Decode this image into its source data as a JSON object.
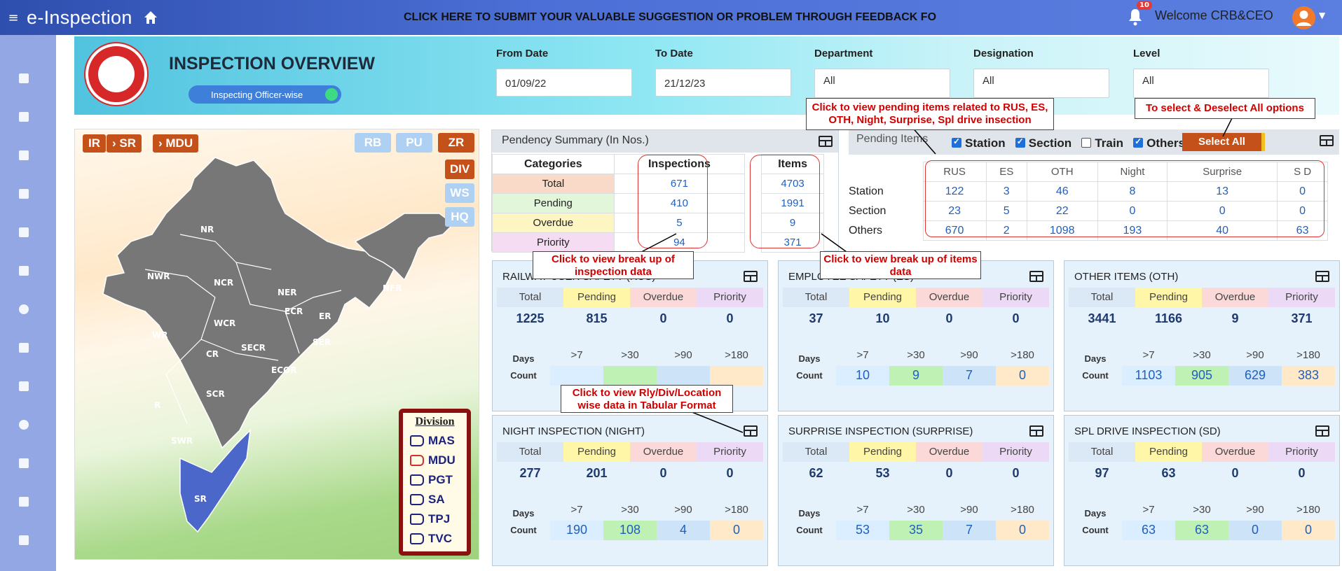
{
  "topbar": {
    "brand": "e-Inspection",
    "feedback": "CLICK HERE TO SUBMIT YOUR VALUABLE SUGGESTION OR PROBLEM THROUGH FEEDBACK FO",
    "notif_count": "10",
    "welcome": "Welcome  CRB&CEO"
  },
  "header": {
    "title": "INSPECTION OVERVIEW",
    "toggle_label": "Inspecting Officer-wise",
    "filters": [
      {
        "label": "From Date",
        "value": "01/09/22"
      },
      {
        "label": "To Date",
        "value": "21/12/23"
      },
      {
        "label": "Department",
        "value": "All"
      },
      {
        "label": "Designation",
        "value": "All"
      },
      {
        "label": "Level",
        "value": "All"
      }
    ]
  },
  "map": {
    "crumbs": [
      "IR",
      "SR",
      "MDU"
    ],
    "zones": [
      "RB",
      "PU",
      "ZR"
    ],
    "levels": [
      "DIV",
      "WS",
      "HQ"
    ],
    "division_title": "Division",
    "divisions": [
      "MAS",
      "MDU",
      "PGT",
      "SA",
      "TPJ",
      "TVC"
    ],
    "labels": [
      "NR",
      "NWR",
      "NCR",
      "NER",
      "NFR",
      "ECR",
      "ER",
      "WR",
      "WCR",
      "CR",
      "SECR",
      "SER",
      "ECOR",
      "SCR",
      "SWR",
      "SR",
      "R"
    ]
  },
  "pendency": {
    "title": "Pendency Summary (In Nos.)",
    "headers": [
      "Categories",
      "Inspections",
      "Items"
    ],
    "rows": [
      [
        "Total",
        "671",
        "4703"
      ],
      [
        "Pending",
        "410",
        "1991"
      ],
      [
        "Overdue",
        "5",
        "9"
      ],
      [
        "Priority",
        "94",
        "371"
      ]
    ]
  },
  "pending_items": {
    "title": "Pending Items",
    "checks": [
      "Station",
      "Section",
      "Train",
      "Others"
    ],
    "select_all": "Select All",
    "cols": [
      "RUS",
      "ES",
      "OTH",
      "Night",
      "Surprise",
      "S D"
    ],
    "rows": [
      [
        "Station",
        "122",
        "3",
        "46",
        "8",
        "13",
        "0"
      ],
      [
        "Section",
        "23",
        "5",
        "22",
        "0",
        "0",
        "0"
      ],
      [
        "Others",
        "670",
        "2",
        "1098",
        "193",
        "40",
        "63"
      ]
    ]
  },
  "callouts": {
    "c1": "Click to view pending items related to RUS, ES, OTH, Night, Surprise, Spl drive insection",
    "c2": "To select & Deselect All options",
    "c3": "Click to view break up of inspection data",
    "c4": "Click to view break up of items data",
    "c5": "Click to view Rly/Div/Location wise data in Tabular Format"
  },
  "card_headers": [
    "Total",
    "Pending",
    "Overdue",
    "Priority"
  ],
  "day_headers": [
    "Days",
    ">7",
    ">30",
    ">90",
    ">180"
  ],
  "count_label": "Count",
  "cards": [
    {
      "title": "RAILWAY USER SAFETY (RUS)",
      "vals": [
        "1225",
        "815",
        "0",
        "0"
      ],
      "counts": [
        "",
        "",
        "",
        ""
      ]
    },
    {
      "title": "EMPLOYEE SAFETY (ES)",
      "vals": [
        "37",
        "10",
        "0",
        "0"
      ],
      "counts": [
        "10",
        "9",
        "7",
        "0"
      ]
    },
    {
      "title": "OTHER ITEMS (OTH)",
      "vals": [
        "3441",
        "1166",
        "9",
        "371"
      ],
      "counts": [
        "1103",
        "905",
        "629",
        "383"
      ]
    },
    {
      "title": "NIGHT INSPECTION (NIGHT)",
      "vals": [
        "277",
        "201",
        "0",
        "0"
      ],
      "counts": [
        "190",
        "108",
        "4",
        "0"
      ]
    },
    {
      "title": "SURPRISE INSPECTION (SURPRISE)",
      "vals": [
        "62",
        "53",
        "0",
        "0"
      ],
      "counts": [
        "53",
        "35",
        "7",
        "0"
      ]
    },
    {
      "title": "SPL DRIVE INSPECTION (SD)",
      "vals": [
        "97",
        "63",
        "0",
        "0"
      ],
      "counts": [
        "63",
        "63",
        "0",
        "0"
      ]
    }
  ]
}
